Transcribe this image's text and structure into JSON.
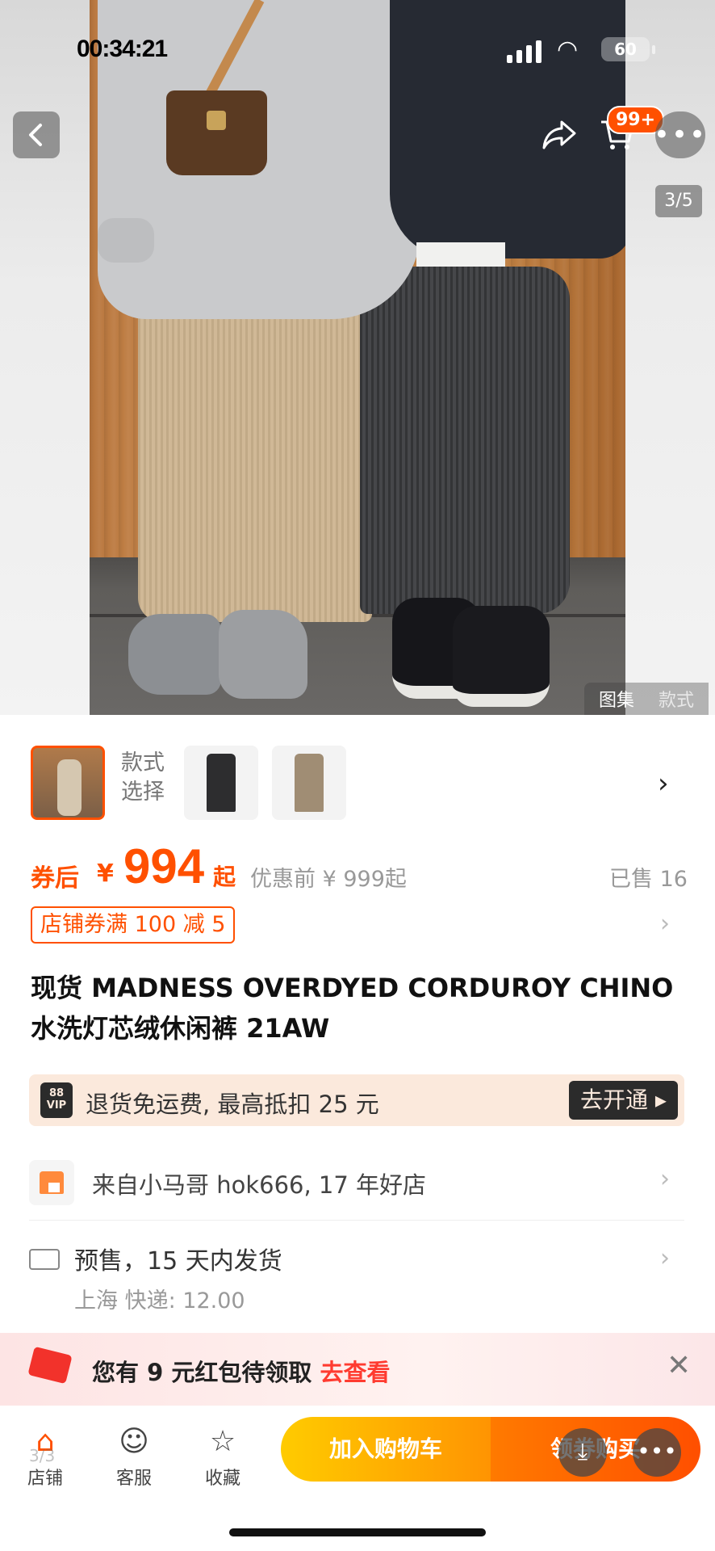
{
  "status_bar": {
    "time": "00:34:21"
  },
  "nav": {
    "back_icon": "chevron-left-icon",
    "share_icon": "share-icon",
    "cart_icon": "cart-icon",
    "cart_badge": "99+",
    "more_icon": "more-icon"
  },
  "gallery": {
    "counter": "3/5",
    "tabs": [
      "图集",
      "款式"
    ]
  },
  "style_picker": {
    "label": "款式选择",
    "thumbnails": [
      "selected-photo",
      "black-pants",
      "khaki-pants"
    ]
  },
  "price": {
    "after_label": "券后",
    "currency": "¥",
    "value": "994",
    "suffix": "起",
    "before": "优惠前 ¥ 999起",
    "sold": "已售 16"
  },
  "coupon": {
    "text": "店铺券满 100 减 5"
  },
  "product": {
    "title": "现货 MADNESS OVERDYED CORDUROY CHINO 水洗灯芯绒休闲裤 21AW"
  },
  "vip": {
    "badge_top": "88",
    "badge_bottom": "VIP",
    "text": "退货免运费, 最高抵扣 25 元",
    "button": "去开通"
  },
  "shop": {
    "text": "来自小马哥 hok666, 17 年好店"
  },
  "delivery": {
    "line1": "预售，15 天内发货",
    "line2": "上海  快递: 12.00"
  },
  "red_packet": {
    "text": "您有 9 元红包待领取 ",
    "link": "去查看"
  },
  "bottom_bar": {
    "tabs": [
      {
        "label": "店铺",
        "icon": "shop-icon"
      },
      {
        "label": "客服",
        "icon": "service-icon"
      },
      {
        "label": "收藏",
        "icon": "star-icon"
      }
    ],
    "add_to_cart": "加入购物车",
    "buy_now": "领券购买"
  },
  "colors": {
    "accent": "#ff5000",
    "cart_yellow": "#ffcb00",
    "buy_orange": "#ff4f00"
  }
}
